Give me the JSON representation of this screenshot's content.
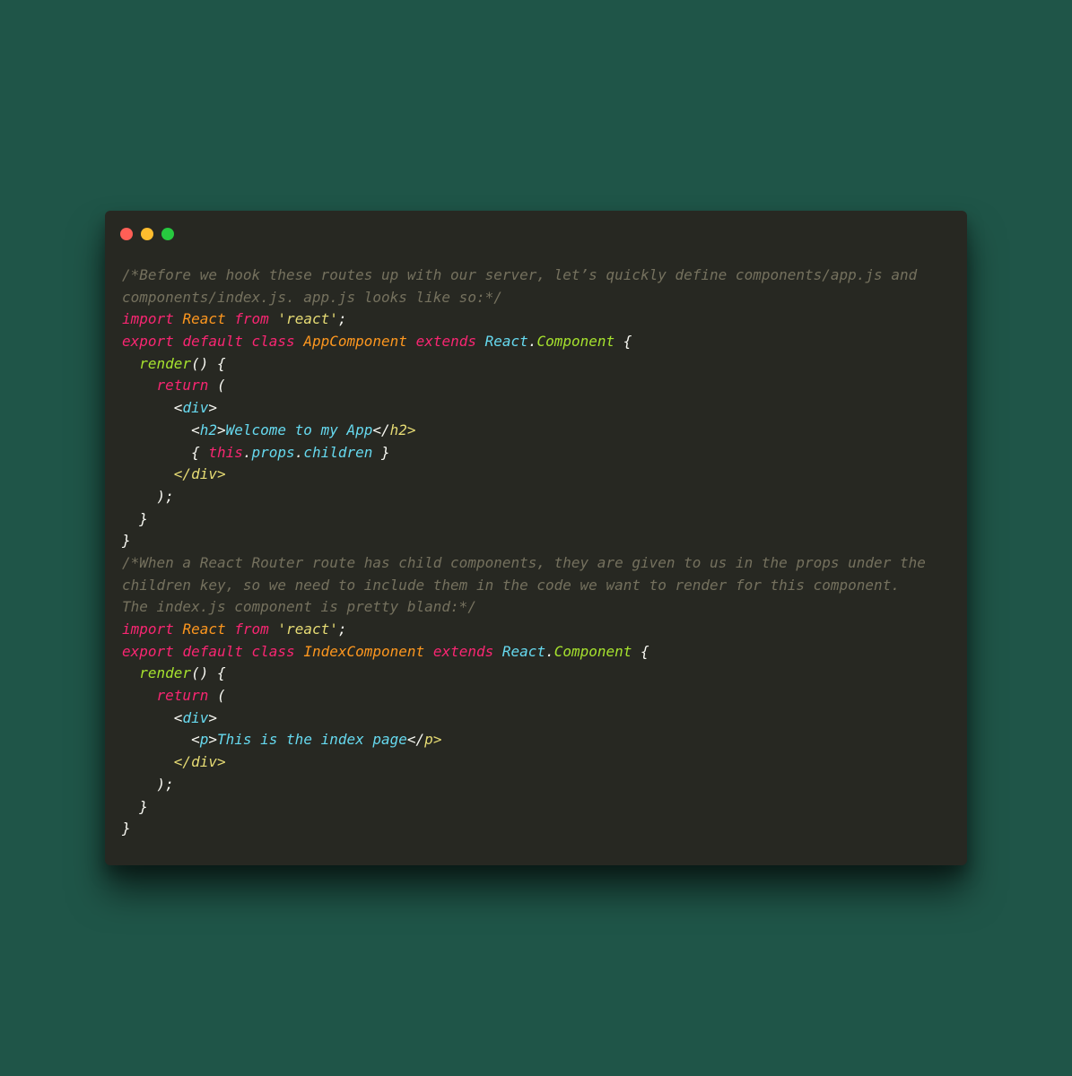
{
  "window": {
    "colors": {
      "background": "#272822",
      "close": "#ff5f56",
      "minimize": "#ffbd2e",
      "maximize": "#27c93f"
    }
  },
  "code": {
    "lines": [
      [
        {
          "t": "/*Before we hook these routes up with our server, let’s quickly define components/app.js and",
          "c": "comment"
        }
      ],
      [
        {
          "t": "components/index.js. app.js looks like so:*/",
          "c": "comment"
        }
      ],
      [
        {
          "t": "import",
          "c": "keyword"
        },
        {
          "t": " ",
          "c": "plain"
        },
        {
          "t": "React",
          "c": "ident"
        },
        {
          "t": " ",
          "c": "plain"
        },
        {
          "t": "from",
          "c": "keyword"
        },
        {
          "t": " ",
          "c": "plain"
        },
        {
          "t": "'react'",
          "c": "string"
        },
        {
          "t": ";",
          "c": "plain"
        }
      ],
      [
        {
          "t": "export",
          "c": "keyword"
        },
        {
          "t": " ",
          "c": "plain"
        },
        {
          "t": "default",
          "c": "keyword"
        },
        {
          "t": " ",
          "c": "plain"
        },
        {
          "t": "class",
          "c": "keyword"
        },
        {
          "t": " ",
          "c": "plain"
        },
        {
          "t": "AppComponent",
          "c": "ident"
        },
        {
          "t": " ",
          "c": "plain"
        },
        {
          "t": "extends",
          "c": "keyword"
        },
        {
          "t": " ",
          "c": "plain"
        },
        {
          "t": "React",
          "c": "builtin"
        },
        {
          "t": ".",
          "c": "plain"
        },
        {
          "t": "Component",
          "c": "func"
        },
        {
          "t": " {",
          "c": "plain"
        }
      ],
      [
        {
          "t": "  ",
          "c": "plain"
        },
        {
          "t": "render",
          "c": "func"
        },
        {
          "t": "() {",
          "c": "plain"
        }
      ],
      [
        {
          "t": "    ",
          "c": "plain"
        },
        {
          "t": "return",
          "c": "keyword"
        },
        {
          "t": " (",
          "c": "plain"
        }
      ],
      [
        {
          "t": "      <",
          "c": "plain"
        },
        {
          "t": "div",
          "c": "tag"
        },
        {
          "t": ">",
          "c": "plain"
        }
      ],
      [
        {
          "t": "        <",
          "c": "plain"
        },
        {
          "t": "h2",
          "c": "tag"
        },
        {
          "t": ">",
          "c": "plain"
        },
        {
          "t": "Welcome to my App",
          "c": "prop"
        },
        {
          "t": "</",
          "c": "plain"
        },
        {
          "t": "h2",
          "c": "closetag"
        },
        {
          "t": ">",
          "c": "closetag"
        }
      ],
      [
        {
          "t": "        { ",
          "c": "plain"
        },
        {
          "t": "this",
          "c": "keyword"
        },
        {
          "t": ".",
          "c": "plain"
        },
        {
          "t": "props",
          "c": "prop"
        },
        {
          "t": ".",
          "c": "plain"
        },
        {
          "t": "children",
          "c": "prop"
        },
        {
          "t": " }",
          "c": "plain"
        }
      ],
      [
        {
          "t": "      </",
          "c": "closetag"
        },
        {
          "t": "div",
          "c": "closetag"
        },
        {
          "t": ">",
          "c": "closetag"
        }
      ],
      [
        {
          "t": "    );",
          "c": "plain"
        }
      ],
      [
        {
          "t": "  }",
          "c": "plain"
        }
      ],
      [
        {
          "t": "}",
          "c": "plain"
        }
      ],
      [
        {
          "t": "/*When a React Router route has child components, they are given to us in the props under the",
          "c": "comment"
        }
      ],
      [
        {
          "t": "children key, so we need to include them in the code we want to render for this component.",
          "c": "comment"
        }
      ],
      [
        {
          "t": "The index.js component is pretty bland:*/",
          "c": "comment"
        }
      ],
      [
        {
          "t": "import",
          "c": "keyword"
        },
        {
          "t": " ",
          "c": "plain"
        },
        {
          "t": "React",
          "c": "ident"
        },
        {
          "t": " ",
          "c": "plain"
        },
        {
          "t": "from",
          "c": "keyword"
        },
        {
          "t": " ",
          "c": "plain"
        },
        {
          "t": "'react'",
          "c": "string"
        },
        {
          "t": ";",
          "c": "plain"
        }
      ],
      [
        {
          "t": "export",
          "c": "keyword"
        },
        {
          "t": " ",
          "c": "plain"
        },
        {
          "t": "default",
          "c": "keyword"
        },
        {
          "t": " ",
          "c": "plain"
        },
        {
          "t": "class",
          "c": "keyword"
        },
        {
          "t": " ",
          "c": "plain"
        },
        {
          "t": "IndexComponent",
          "c": "ident"
        },
        {
          "t": " ",
          "c": "plain"
        },
        {
          "t": "extends",
          "c": "keyword"
        },
        {
          "t": " ",
          "c": "plain"
        },
        {
          "t": "React",
          "c": "builtin"
        },
        {
          "t": ".",
          "c": "plain"
        },
        {
          "t": "Component",
          "c": "func"
        },
        {
          "t": " {",
          "c": "plain"
        }
      ],
      [
        {
          "t": "  ",
          "c": "plain"
        },
        {
          "t": "render",
          "c": "func"
        },
        {
          "t": "() {",
          "c": "plain"
        }
      ],
      [
        {
          "t": "    ",
          "c": "plain"
        },
        {
          "t": "return",
          "c": "keyword"
        },
        {
          "t": " (",
          "c": "plain"
        }
      ],
      [
        {
          "t": "      <",
          "c": "plain"
        },
        {
          "t": "div",
          "c": "tag"
        },
        {
          "t": ">",
          "c": "plain"
        }
      ],
      [
        {
          "t": "        <",
          "c": "plain"
        },
        {
          "t": "p",
          "c": "tag"
        },
        {
          "t": ">",
          "c": "plain"
        },
        {
          "t": "This is the index page",
          "c": "prop"
        },
        {
          "t": "</",
          "c": "plain"
        },
        {
          "t": "p",
          "c": "closetag"
        },
        {
          "t": ">",
          "c": "closetag"
        }
      ],
      [
        {
          "t": "      </",
          "c": "closetag"
        },
        {
          "t": "div",
          "c": "closetag"
        },
        {
          "t": ">",
          "c": "closetag"
        }
      ],
      [
        {
          "t": "    );",
          "c": "plain"
        }
      ],
      [
        {
          "t": "  }",
          "c": "plain"
        }
      ],
      [
        {
          "t": "}",
          "c": "plain"
        }
      ]
    ]
  }
}
